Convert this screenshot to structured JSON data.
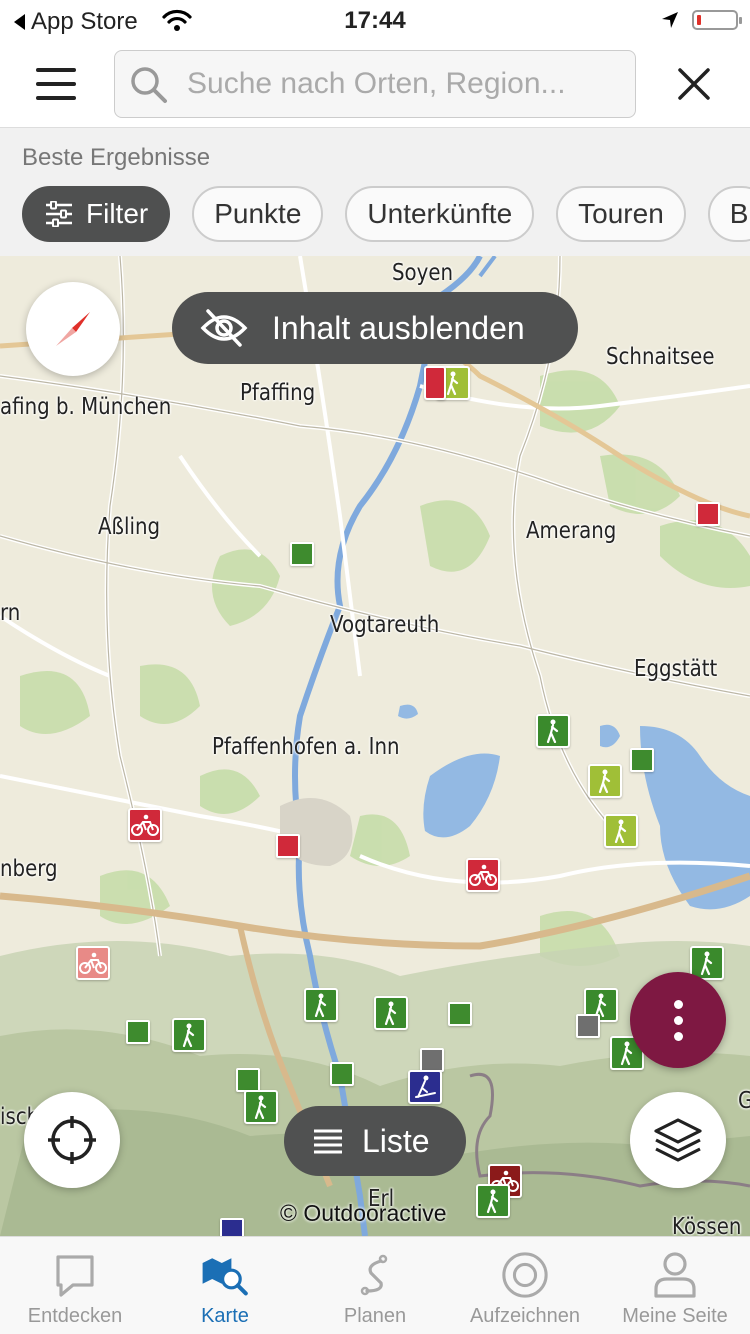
{
  "status_bar": {
    "back_label": "App Store",
    "time": "17:44",
    "icons": [
      "wifi-icon",
      "location-arrow-icon",
      "battery-low-icon"
    ]
  },
  "search": {
    "placeholder": "Suche nach Orten, Region...",
    "value": ""
  },
  "filter_bar": {
    "title": "Beste Ergebnisse",
    "chips": [
      "Filter",
      "Punkte",
      "Unterkünfte",
      "Touren",
      "B"
    ]
  },
  "map": {
    "hide_content_label": "Inhalt ausblenden",
    "list_label": "Liste",
    "copyright": "© Outdooractive",
    "places": [
      "Soyen",
      "Schnaitsee",
      "Pfaffing",
      "afing b. München",
      "Aßling",
      "Amerang",
      "rn",
      "Vogtareuth",
      "Eggstätt",
      "Pfaffenhofen a. Inn",
      "nberg",
      "isch",
      "Erl",
      "Kössen",
      "G"
    ],
    "colors": {
      "hiking": "#3a8a2c",
      "cycling": "#d0293a",
      "poi_green": "#3e8b2e",
      "poi_lime": "#a0bf37",
      "poi_red": "#d0293a",
      "poi_grey": "#6f6f6f",
      "winter": "#2b2d8f",
      "action": "#7e1842",
      "water": "#8fb7e3",
      "forest": "#bdd9a0"
    }
  },
  "tab_bar": {
    "tabs": [
      {
        "label": "Entdecken",
        "icon": "speech-bubble-icon",
        "active": false
      },
      {
        "label": "Karte",
        "icon": "map-search-icon",
        "active": true
      },
      {
        "label": "Planen",
        "icon": "route-icon",
        "active": false
      },
      {
        "label": "Aufzeichnen",
        "icon": "record-icon",
        "active": false
      },
      {
        "label": "Meine Seite",
        "icon": "profile-icon",
        "active": false
      }
    ]
  }
}
